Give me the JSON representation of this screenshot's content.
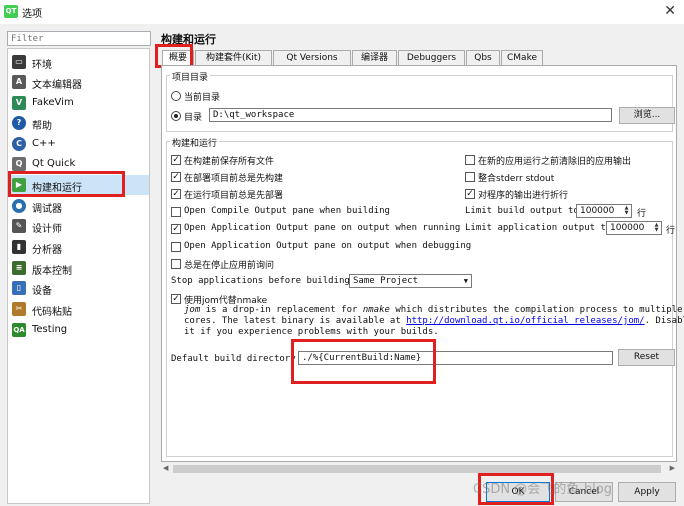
{
  "window": {
    "title": "选项",
    "app_icon": "QT",
    "close_glyph": "✕"
  },
  "filter": {
    "placeholder": "Filter"
  },
  "sidebar": {
    "items": [
      {
        "label": "环境",
        "icon": "monitor-icon",
        "color": "#3a3a3a",
        "glyph": "▭"
      },
      {
        "label": "文本编辑器",
        "icon": "text-editor-icon",
        "color": "#5a5a5a",
        "glyph": "A"
      },
      {
        "label": "FakeVim",
        "icon": "fakevim-icon",
        "color": "#2e8b57",
        "glyph": "V"
      },
      {
        "label": "帮助",
        "icon": "help-icon",
        "color": "#1e5aa8",
        "glyph": "?"
      },
      {
        "label": "C++",
        "icon": "cpp-icon",
        "color": "#2c5fa8",
        "glyph": "C"
      },
      {
        "label": "Qt Quick",
        "icon": "qt-quick-icon",
        "color": "#6e6e6e",
        "glyph": "Q"
      },
      {
        "label": "构建和运行",
        "icon": "build-run-icon",
        "color": "#41a041",
        "glyph": "▶"
      },
      {
        "label": "调试器",
        "icon": "debugger-icon",
        "color": "#2a6fb0",
        "glyph": "●"
      },
      {
        "label": "设计师",
        "icon": "designer-icon",
        "color": "#555555",
        "glyph": "✎"
      },
      {
        "label": "分析器",
        "icon": "analyzer-icon",
        "color": "#333333",
        "glyph": "▮"
      },
      {
        "label": "版本控制",
        "icon": "version-control-icon",
        "color": "#3d6b2e",
        "glyph": "≡"
      },
      {
        "label": "设备",
        "icon": "devices-icon",
        "color": "#3870b8",
        "glyph": "▯"
      },
      {
        "label": "代码粘贴",
        "icon": "code-paster-icon",
        "color": "#b07a2a",
        "glyph": "✂"
      },
      {
        "label": "Testing",
        "icon": "testing-icon",
        "color": "#2d8a2d",
        "glyph": "QA"
      }
    ]
  },
  "page": {
    "title": "构建和运行"
  },
  "tabs": [
    "概要",
    "构建套件(Kit)",
    "Qt Versions",
    "编译器",
    "Debuggers",
    "Qbs",
    "CMake"
  ],
  "project_dir": {
    "group_title": "项目目录",
    "current_dir_label": "当前目录",
    "dir_label": "目录",
    "dir_value": "D:\\qt_workspace",
    "browse_label": "浏览..."
  },
  "build_run": {
    "group_title": "构建和运行",
    "save_before_build": "在构建前保存所有文件",
    "build_before_deploy": "在部署项目前总是先构建",
    "deploy_before_run": "在运行项目前总是先部署",
    "open_compile_pane": "Open Compile Output pane when building",
    "open_app_pane_running": "Open Application Output pane on output when running",
    "open_app_pane_debugging": "Open Application Output pane on output when debugging",
    "ask_before_stop": "总是在停止应用前询问",
    "clear_old_output": "在新的应用运行之前清除旧的应用输出",
    "merge_stderr": "整合stderr stdout",
    "wrap_output": "对程序的输出进行折行",
    "limit_build_label": "Limit build output to",
    "limit_build_value": "100000",
    "limit_app_label": "Limit application output to",
    "limit_app_value": "100000",
    "lines_unit": "行",
    "stop_apps_label": "Stop applications before building:",
    "stop_apps_value": "Same Project",
    "jom_label": "使用jom代替nmake",
    "jom_desc_1_a": "jom",
    "jom_desc_1_b": " is a drop-in replacement for ",
    "jom_desc_1_c": "nmake",
    "jom_desc_1_d": " which distributes the compilation process to multiple CPU",
    "jom_desc_2_a": "cores. The latest binary is available at ",
    "jom_desc_2_link": "http://download.qt.io/official_releases/jom/",
    "jom_desc_2_b": ". Disable",
    "jom_desc_3": "it if you experience problems with your builds.",
    "default_build_dir_label": "Default build directory",
    "default_build_dir_value": "./%{CurrentBuild:Name}",
    "reset_label": "Reset"
  },
  "checkboxes": {
    "save_before_build": true,
    "build_before_deploy": true,
    "deploy_before_run": true,
    "open_compile_pane": false,
    "open_app_pane_running": true,
    "open_app_pane_debugging": false,
    "ask_before_stop": false,
    "clear_old_output": false,
    "merge_stderr": false,
    "wrap_output": true,
    "jom": true
  },
  "footer": {
    "ok_label": "OK",
    "cancel_label": "Cancel",
    "apply_label": "Apply"
  },
  "watermark": "CSDN @会飞的鱼-blog",
  "colors": {
    "highlight": "#e02020",
    "active_item": "#cce4f7",
    "link": "#0000ee"
  }
}
